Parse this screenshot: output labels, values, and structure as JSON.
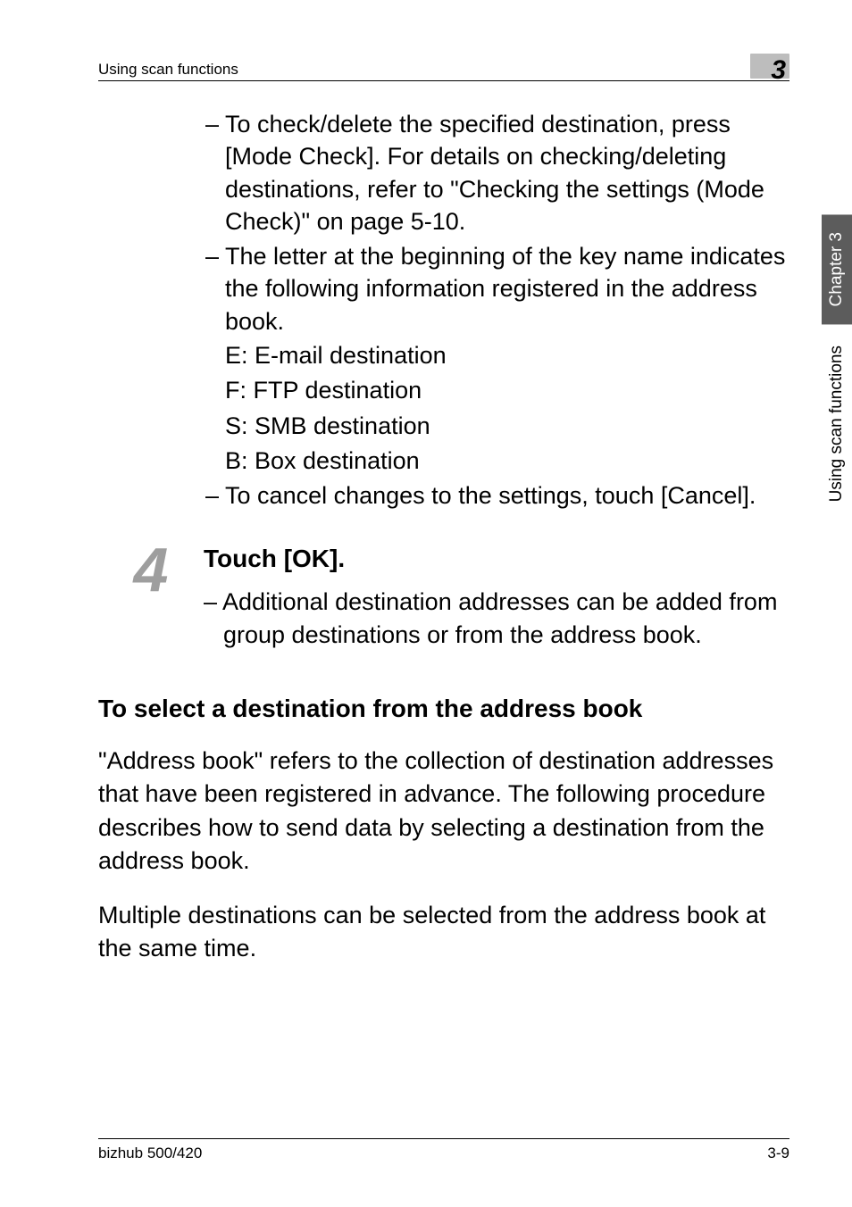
{
  "header": {
    "title": "Using scan functions",
    "chapter_number": "3"
  },
  "bullets": {
    "b1": "– To check/delete the specified destination, press [Mode Check]. For details on checking/deleting destinations, refer to \"Checking the settings (Mode Check)\" on page 5-10.",
    "b2": "– The letter at the beginning of the key name indicates the following information registered in the address book.",
    "b2a": "E: E-mail destination",
    "b2b": "F: FTP destination",
    "b2c": "S: SMB destination",
    "b2d": "B: Box destination",
    "b3": "– To cancel changes to the settings, touch [Cancel]."
  },
  "step": {
    "number": "4",
    "title": "Touch [OK].",
    "note": "– Additional destination addresses can be added from group destinations or from the address book."
  },
  "section": {
    "heading": "To select a destination from the address book",
    "para1": "\"Address book\" refers to the collection of destination addresses that have been registered in advance. The following procedure describes how to send data by selecting a destination from the address book.",
    "para2": "Multiple destinations can be selected from the address book at the same time."
  },
  "sidetab": {
    "dark": "Chapter 3",
    "light": "Using scan functions"
  },
  "footer": {
    "left": "bizhub 500/420",
    "right": "3-9"
  }
}
